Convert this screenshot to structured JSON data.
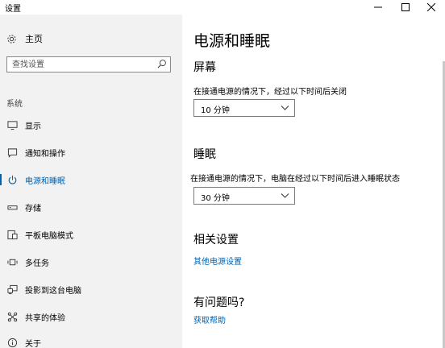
{
  "window": {
    "title": "设置"
  },
  "sidebar": {
    "home_label": "主页",
    "search_placeholder": "查找设置",
    "section_label": "系统",
    "items": [
      {
        "label": "显示",
        "icon": "monitor-icon",
        "active": false
      },
      {
        "label": "通知和操作",
        "icon": "notification-icon",
        "active": false
      },
      {
        "label": "电源和睡眠",
        "icon": "power-icon",
        "active": true
      },
      {
        "label": "存储",
        "icon": "storage-icon",
        "active": false
      },
      {
        "label": "平板电脑模式",
        "icon": "tablet-mode-icon",
        "active": false
      },
      {
        "label": "多任务",
        "icon": "multitasking-icon",
        "active": false
      },
      {
        "label": "投影到这台电脑",
        "icon": "projecting-icon",
        "active": false
      },
      {
        "label": "共享的体验",
        "icon": "shared-experience-icon",
        "active": false
      },
      {
        "label": "关于",
        "icon": "info-icon",
        "active": false
      }
    ]
  },
  "main": {
    "title": "电源和睡眠",
    "screen": {
      "heading": "屏幕",
      "description": "在接通电源的情况下，经过以下时间后关闭",
      "value": "10 分钟"
    },
    "sleep": {
      "heading": "睡眠",
      "description": "在接通电源的情况下，电脑在经过以下时间后进入睡眠状态",
      "value": "30 分钟"
    },
    "related": {
      "heading": "相关设置",
      "link": "其他电源设置"
    },
    "help": {
      "heading": "有问题吗?",
      "link": "获取帮助"
    }
  },
  "colors": {
    "accent": "#0063b1",
    "sidebar_bg": "#f2f2f2"
  }
}
